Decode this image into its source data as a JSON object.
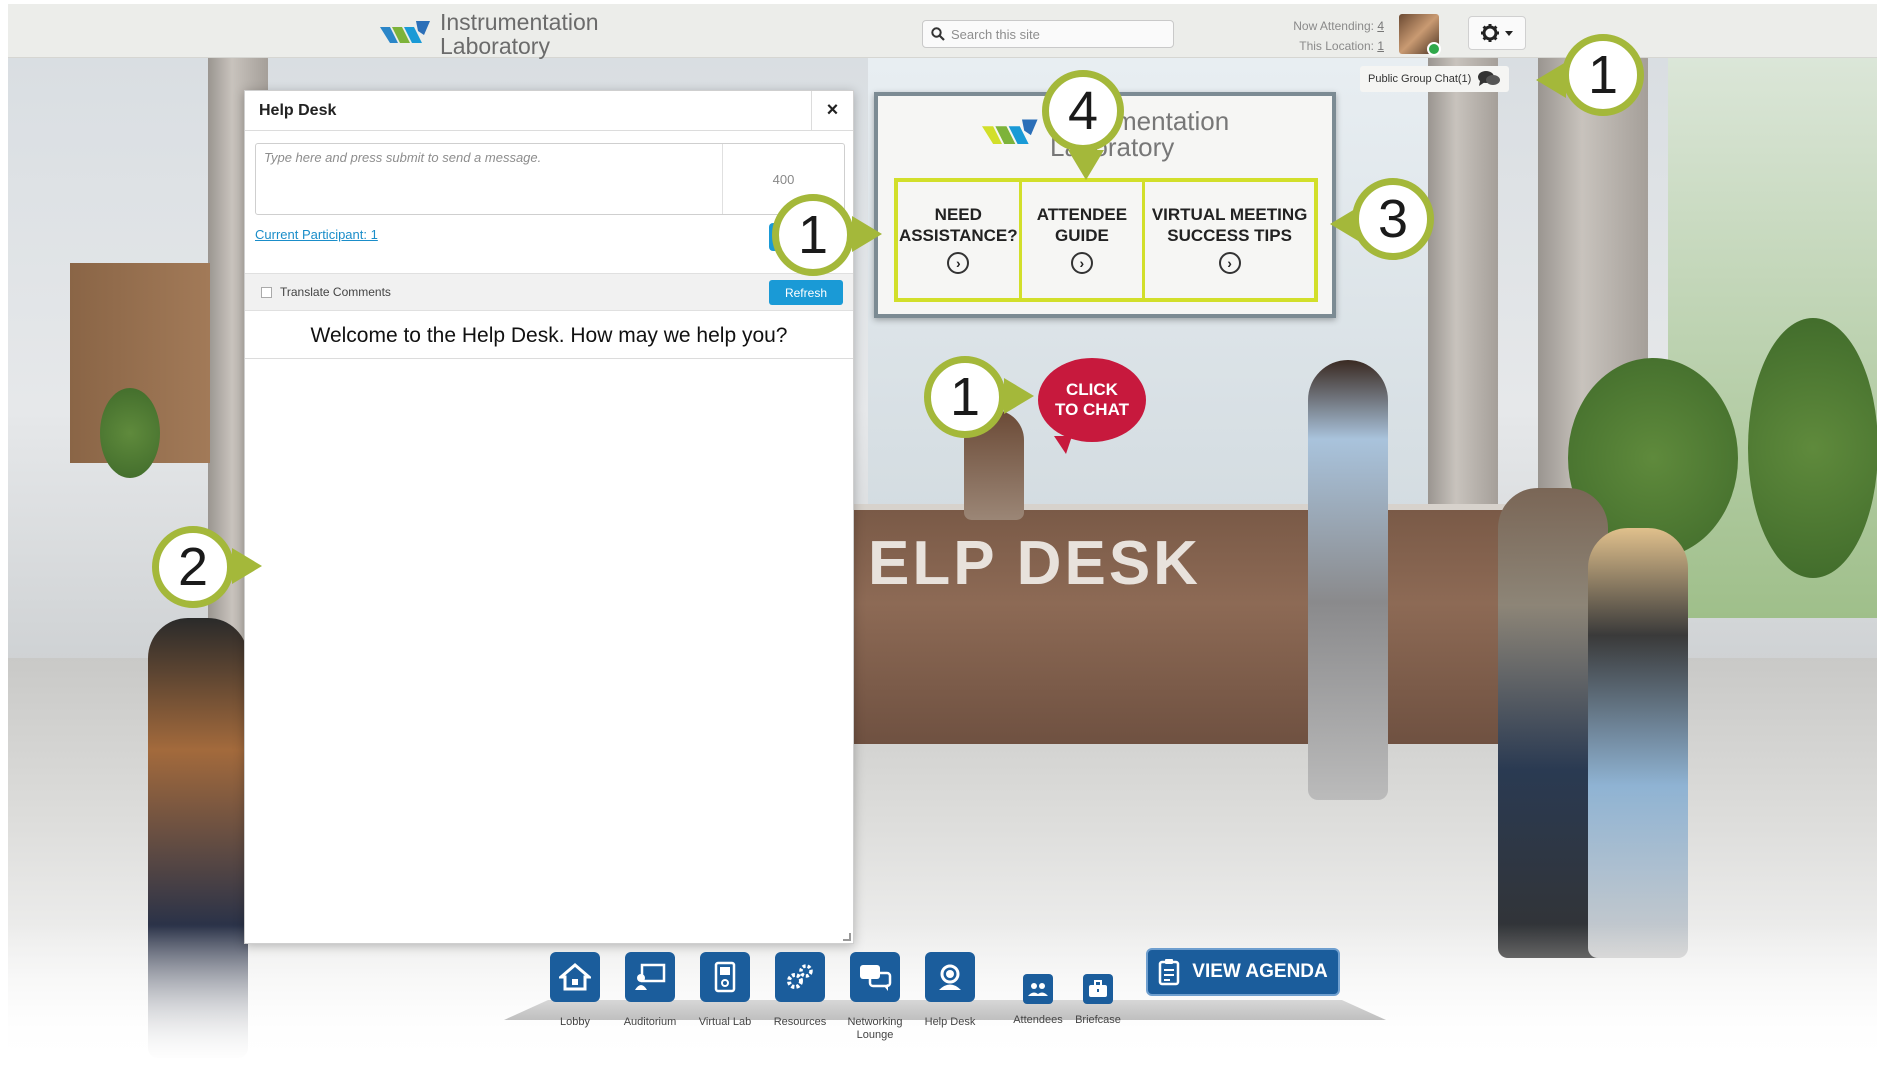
{
  "header": {
    "logo_line1": "Instrumentation",
    "logo_line2": "Laboratory",
    "search_placeholder": "Search this site",
    "now_attending_label": "Now Attending:",
    "now_attending_count": "4",
    "this_location_label": "This Location:",
    "this_location_count": "1"
  },
  "public_chat": {
    "label": "Public Group Chat(1)"
  },
  "help_desk_dialog": {
    "title": "Help Desk",
    "close": "×",
    "message_placeholder": "Type here and press submit to send a message.",
    "char_limit": "400",
    "participants_link": "Current Participant: 1",
    "translate_label": "Translate Comments",
    "refresh_label": "Refresh",
    "welcome_message": "Welcome to the Help Desk.  How may we help you?"
  },
  "sign": {
    "logo_line1": "Instrumentation",
    "logo_line2": "Laboratory",
    "items": [
      {
        "line1": "NEED",
        "line2": "ASSISTANCE?"
      },
      {
        "line1": "ATTENDEE",
        "line2": "GUIDE"
      },
      {
        "line1": "VIRTUAL MEETING",
        "line2": "SUCCESS TIPS"
      }
    ]
  },
  "desk_text": "ELP DESK",
  "chat_bubble": {
    "line1": "CLICK",
    "line2": "TO CHAT"
  },
  "callouts": [
    "1",
    "1",
    "1",
    "2",
    "3",
    "4"
  ],
  "nav": {
    "items": [
      {
        "label": "Lobby",
        "icon": "home-icon"
      },
      {
        "label": "Auditorium",
        "icon": "presentation-icon"
      },
      {
        "label": "Virtual Lab",
        "icon": "lab-icon"
      },
      {
        "label": "Resources",
        "icon": "gears-icon"
      },
      {
        "label": "Networking Lounge",
        "icon": "chat-bubbles-icon"
      },
      {
        "label": "Help Desk",
        "icon": "support-agent-icon"
      },
      {
        "label": "Attendees",
        "icon": "people-icon"
      },
      {
        "label": "Briefcase",
        "icon": "briefcase-icon"
      }
    ],
    "agenda_label": "VIEW AGENDA"
  },
  "colors": {
    "brand_blue": "#1b5d9c",
    "accent_blue": "#1a9ad6",
    "callout_green": "#a4b83a",
    "sign_yellow": "#d2df2a",
    "chat_red": "#c7193d"
  }
}
